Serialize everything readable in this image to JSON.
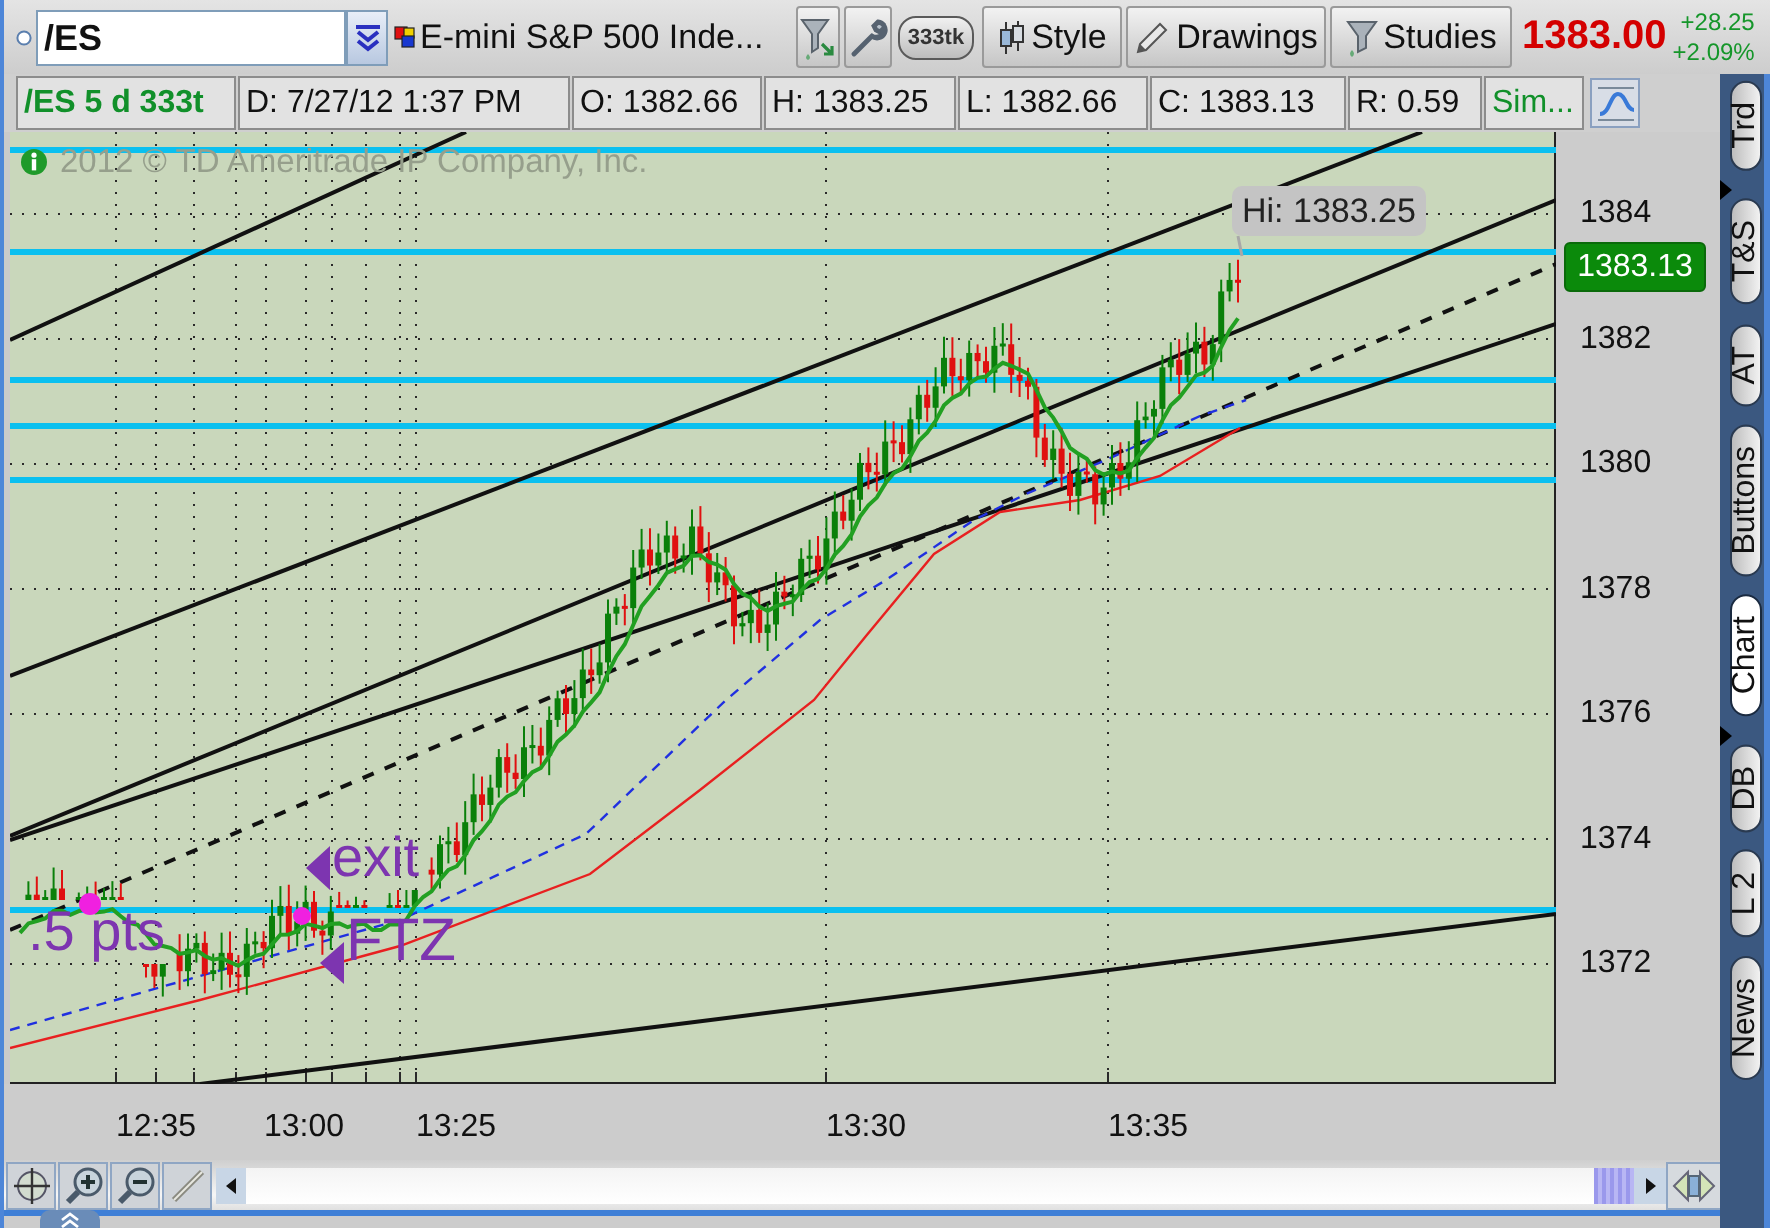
{
  "header": {
    "symbol": "/ES",
    "description": "E-mini S&P 500 Inde...",
    "tick_setting": "333tk",
    "buttons": [
      "Style",
      "Drawings",
      "Studies"
    ],
    "last_price": "1383.00",
    "net_change": "+28.25",
    "percent_change": "+2.09%"
  },
  "info_bar": [
    {
      "kind": "title",
      "text": "/ES 5 d 333t"
    },
    {
      "kind": "value",
      "text": "D: 7/27/12 1:37 PM"
    },
    {
      "kind": "value",
      "text": "O: 1382.66"
    },
    {
      "kind": "value",
      "text": "H: 1383.25"
    },
    {
      "kind": "value",
      "text": "L: 1382.66"
    },
    {
      "kind": "value",
      "text": "C: 1383.13"
    },
    {
      "kind": "value",
      "text": "R: 0.59"
    },
    {
      "kind": "mode",
      "text": "Sim..."
    }
  ],
  "chart": {
    "copyright": "2012 © TD Ameritrade IP Company, Inc.",
    "high_callout": "Hi: 1383.25",
    "annotations": [
      {
        "kind": "text",
        "text": ".5 pts"
      },
      {
        "kind": "arrow",
        "text": "exit"
      },
      {
        "kind": "arrow",
        "text": "FTZ"
      }
    ],
    "price_labels": [
      "1384",
      "1382",
      "1380",
      "1378",
      "1376",
      "1374",
      "1372"
    ],
    "last_price_tag": "1383.13",
    "time_labels": [
      "12:35",
      "13:00",
      "13:25",
      "13:30",
      "13:35"
    ]
  },
  "side_tabs": [
    {
      "label": "Trd",
      "selected": false
    },
    {
      "label": "T&S",
      "selected": false
    },
    {
      "label": "AT",
      "selected": false
    },
    {
      "label": "Buttons",
      "selected": false
    },
    {
      "label": "Chart",
      "selected": true
    },
    {
      "label": "DB",
      "selected": false
    },
    {
      "label": "L 2",
      "selected": false
    },
    {
      "label": "News",
      "selected": false
    }
  ]
}
